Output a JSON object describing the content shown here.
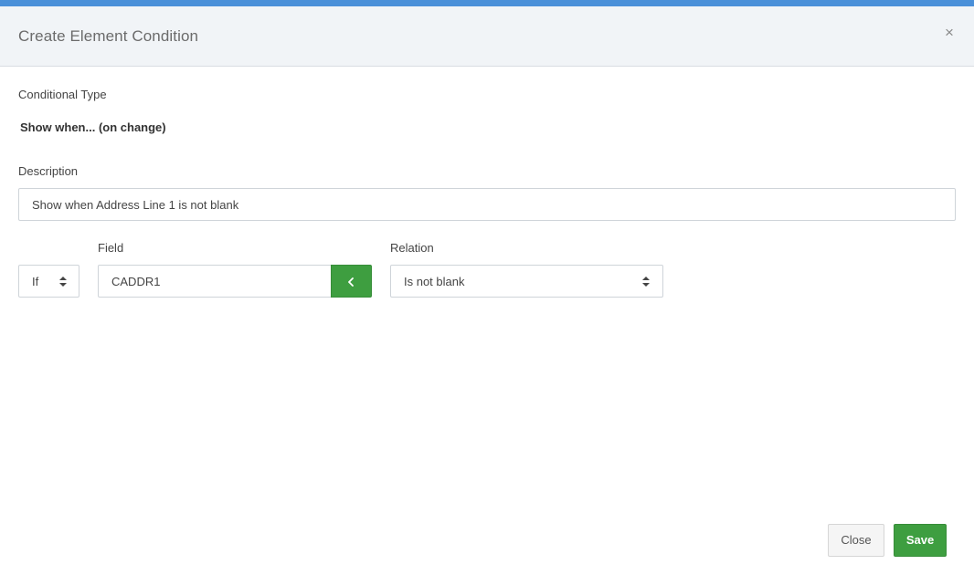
{
  "modal": {
    "title": "Create Element Condition",
    "close_icon": "close-icon"
  },
  "conditional_type": {
    "label": "Conditional Type",
    "value": "Show when... (on change)"
  },
  "description": {
    "label": "Description",
    "value": "Show when Address Line 1 is not blank"
  },
  "condition_row": {
    "operator": {
      "value": "If",
      "icon": "sort-arrows-icon"
    },
    "field": {
      "label": "Field",
      "value": "CADDR1",
      "picker_icon": "chevron-left-icon"
    },
    "relation": {
      "label": "Relation",
      "value": "Is not blank",
      "icon": "sort-arrows-icon"
    }
  },
  "footer": {
    "close_label": "Close",
    "save_label": "Save"
  },
  "colors": {
    "accent_bar": "#4a90d9",
    "header_bg": "#f1f4f7",
    "success_green": "#3e9e40"
  }
}
